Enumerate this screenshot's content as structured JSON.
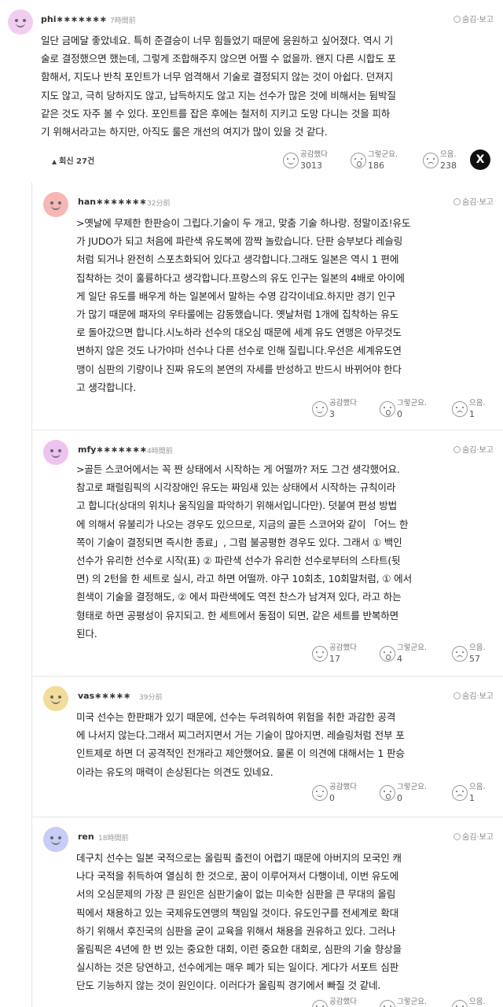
{
  "top_comment": {
    "nickname": "phi∗∗∗∗∗∗∗",
    "time": "7時間前",
    "hide_report": "숨김·보고",
    "avatar_color": "#f2cdf2",
    "lines": [
      "일단 금메달 좋았네요. 특히 준결승이 너무 힘들었기 때문에 응원하고 싶어졌다. 역시 기",
      "술로 결정했으면 했는데, 그렇게 조합해주지 않으면 어쩔 수 없을까. 왠지 다른 시합도 포",
      "함해서, 지도나 반칙 포인트가 너무 엄격해서 기술로 결정되지 않는 것이 아쉽다. 던져지",
      "지도 않고, 극히 당하지도 않고, 납득하지도 않고 지는 선수가 많은 것에 비해서는 뒴박질",
      "같은 것도 자주 볼 수 있다. 포인트를 잡은 후에는 철저히 지키고 도망 다니는 것을 피하",
      "기 위해서라고는 하지만, 아직도 룰은 개선의 여지가 많이 있을 것 같다."
    ],
    "reply_toggle": "회신 27건",
    "reactions": [
      {
        "label": "공감했다",
        "count": "3013",
        "icon": "smile-face-icon"
      },
      {
        "label": "그렇군요.",
        "count": "186",
        "icon": "wow-face-icon"
      },
      {
        "label": "으음.",
        "count": "238",
        "icon": "sad-face-icon"
      }
    ],
    "share_label": "X"
  },
  "replies": [
    {
      "nickname": "han∗∗∗∗∗∗∗",
      "time": "32分前",
      "hide_report": "숨김·보고",
      "avatar_color": "#f7b6b6",
      "lines": [
        ">옛날에 무제한 한판승이 그립다.기술이 두 개고, 맞춤 기술 하나랑. 정말이죠!유도",
        "가 JUDO가 되고 처음에 파란색 유도복에 깜짝 놀랐습니다. 단판 승부보다 레슬링",
        "처럼 되거나 완전히 스포츠화되어 있다고 생각합니다.그래도 일본은 역시 1 편에",
        "집착하는 것이 훌륭하다고 생각합니다.프랑스의 유도 인구는 일본의 4배로 아이에",
        "게 일단 유도를 배우게 하는 일본에서 말하는 수영 감각이네요.하지만 경기 인구",
        "가 많기 때문에 패자의 우타룰에는 감동했습니다. 옛날처럼 1개에 집착하는 유도",
        "로 돌아갔으면 합니다.시노하라 선수의 대오심 때문에 세계 유도 연맹은 아무것도",
        "변하지 않은 것도 나가야마 선수나 다른 선수로 인해 질립니다.우선은 세계유도연",
        "맹이 심판의 기량이나 진짜 유도의 본연의 자세를 반성하고 반드시 바뀌어야 한다",
        "고 생각합니다."
      ],
      "reactions": [
        {
          "label": "공감했다",
          "count": "3",
          "icon": "smile-face-icon"
        },
        {
          "label": "그렇군요.",
          "count": "0",
          "icon": "wow-face-icon"
        },
        {
          "label": "으음.",
          "count": "1",
          "icon": "sad-face-icon"
        }
      ]
    },
    {
      "nickname": "mfy∗∗∗∗∗∗∗",
      "time": "4時間前",
      "hide_report": "숨김·보고",
      "avatar_color": "#efc3ef",
      "lines": [
        ">골든 스코어에서는 꼭 짠 상태에서 시작하는 게 어떨까? 저도 그건 생각했어요.",
        "참고로 패럴림픽의 시각장애인 유도는 짜임새 있는 상태에서 시작하는 규칙이라",
        "고 합니다(상대의 위치나 움직임을 파악하기 위해서입니다만). 덧붙여 편성 방법",
        "에 의해서 유불리가 나오는 경우도 있으므로, 지금의 골든 스코어와 같이 「어느 한",
        "쪽이 기술이 결정되면 즉시한 종료」, 그럼 불공평한 경우도 있다. 그래서 ① 백인",
        "선수가 유리한 선수로 시작(표) ② 파란색 선수가 유리한 선수로부터의 스타트(뒷",
        "면) 의 2턴을 한 세트로 실시, 라고 하면 어떨까. 야구 10회초, 10회말처럼, ① 에서",
        "흰색이 기술을 결정해도, ② 에서 파란색에도 역전 찬스가 남겨져 있다, 라고 하는",
        "형태로 하면 공평성이 유지되고. 한 세트에서 동점이 되면, 같은 세트를 반복하면",
        "된다."
      ],
      "reactions": [
        {
          "label": "공감했다",
          "count": "17",
          "icon": "smile-face-icon"
        },
        {
          "label": "그렇군요.",
          "count": "4",
          "icon": "wow-face-icon"
        },
        {
          "label": "으음.",
          "count": "57",
          "icon": "sad-face-icon"
        }
      ]
    },
    {
      "nickname": "vas∗∗∗∗∗",
      "time": "39分前",
      "hide_report": "숨김·보고",
      "avatar_color": "#f2dc9a",
      "lines": [
        "미국 선수는 한판패가 있기 때문에, 선수는 두려워하여 위험을 취한 과감한 공격",
        "에 나서지 않는다.그래서 찌그러지면서 거는 기술이 많아지면. 레슬링처럼 전부 포",
        "인트제로 하면 더 공격적인 전개라고 제안했어요. 물론 이 의견에 대해서는 1 판승",
        "이라는 유도의 매력이 손상된다는 의견도 있네요."
      ],
      "reactions": [
        {
          "label": "공감했다",
          "count": "0",
          "icon": "smile-face-icon"
        },
        {
          "label": "그렇군요.",
          "count": "0",
          "icon": "wow-face-icon"
        },
        {
          "label": "으음.",
          "count": "1",
          "icon": "sad-face-icon"
        }
      ]
    },
    {
      "nickname": "ren",
      "time": "18時間前",
      "hide_report": "숨김·보고",
      "avatar_color": "#c7cdf5",
      "lines": [
        "데구치 선수는 일본 국적으로는 올림픽 출전이 어렵기 때문에 아버지의 모국인 캐",
        "나다 국적을 취득하여 열심히 한 것으로, 꿈이 이루어져서 다행이네, 이번 유도에",
        "서의 오심문제의 가장 큰 원인은 심판기술이 없는 미숙한 심판을 큰 무대의 올림",
        "픽에서 채용하고 있는 국제유도연맹의 책임일 것이다. 유도인구를 전세계로 확대",
        "하기 위해서 후진국의 심판을 굳이 교육을 위해서 채용을 권유하고 있다. 그러나",
        "올림픽은 4년에 한 번 있는 중요한 대회, 이런 중요한 대회로, 심판의 기술 향상을",
        "실시하는 것은 당연하고, 선수에게는 매우 폐가 되는 일이다. 게다가 서포트 심판",
        "단도 기능하지 않는 것이 원인이다. 이러다가 올림픽 경기에서 빠질 것 같네."
      ],
      "reactions": [
        {
          "label": "공감했다",
          "count": "",
          "icon": "smile-face-icon"
        },
        {
          "label": "그렇군요.",
          "count": "",
          "icon": "wow-face-icon"
        },
        {
          "label": "으음.",
          "count": "",
          "icon": "sad-face-icon"
        }
      ]
    }
  ]
}
